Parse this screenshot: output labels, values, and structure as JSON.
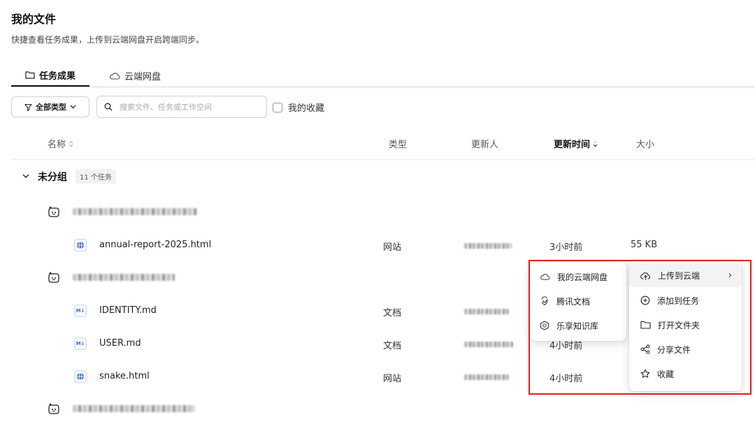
{
  "page": {
    "title": "我的文件",
    "subtitle": "快捷查看任务成果，上传到云端网盘开启跨端同步。"
  },
  "tabs": [
    {
      "label": "任务成果"
    },
    {
      "label": "云端网盘"
    }
  ],
  "toolbar": {
    "filter_label": "全部类型",
    "search_placeholder": "搜索文件、任务或工作空间",
    "favorites_label": "我的收藏"
  },
  "columns": {
    "name": "名称",
    "type": "类型",
    "updater": "更新人",
    "updated": "更新时间",
    "size": "大小"
  },
  "group": {
    "name": "未分组",
    "badge": "11 个任务"
  },
  "files": [
    {
      "name": "annual-report-2025.html",
      "type": "网站",
      "time": "3小时前",
      "size": "55 KB"
    },
    {
      "name": "IDENTITY.md",
      "type": "文档",
      "time": "",
      "size": ""
    },
    {
      "name": "USER.md",
      "type": "文档",
      "time": "4小时前",
      "size": ""
    },
    {
      "name": "snake.html",
      "type": "网站",
      "time": "4小时前",
      "size": ""
    }
  ],
  "context_menu": {
    "items": [
      {
        "label": "上传到云端",
        "chevron": "›"
      },
      {
        "label": "添加到任务"
      },
      {
        "label": "打开文件夹"
      },
      {
        "label": "分享文件"
      },
      {
        "label": "收藏"
      }
    ]
  },
  "submenu": {
    "items": [
      {
        "label": "我的云端网盘"
      },
      {
        "label": "腾讯文档"
      },
      {
        "label": "乐享知识库"
      }
    ]
  },
  "colors": {
    "highlight_box": "#e51c1c",
    "file_icon_accent": "#3b6fd8"
  }
}
